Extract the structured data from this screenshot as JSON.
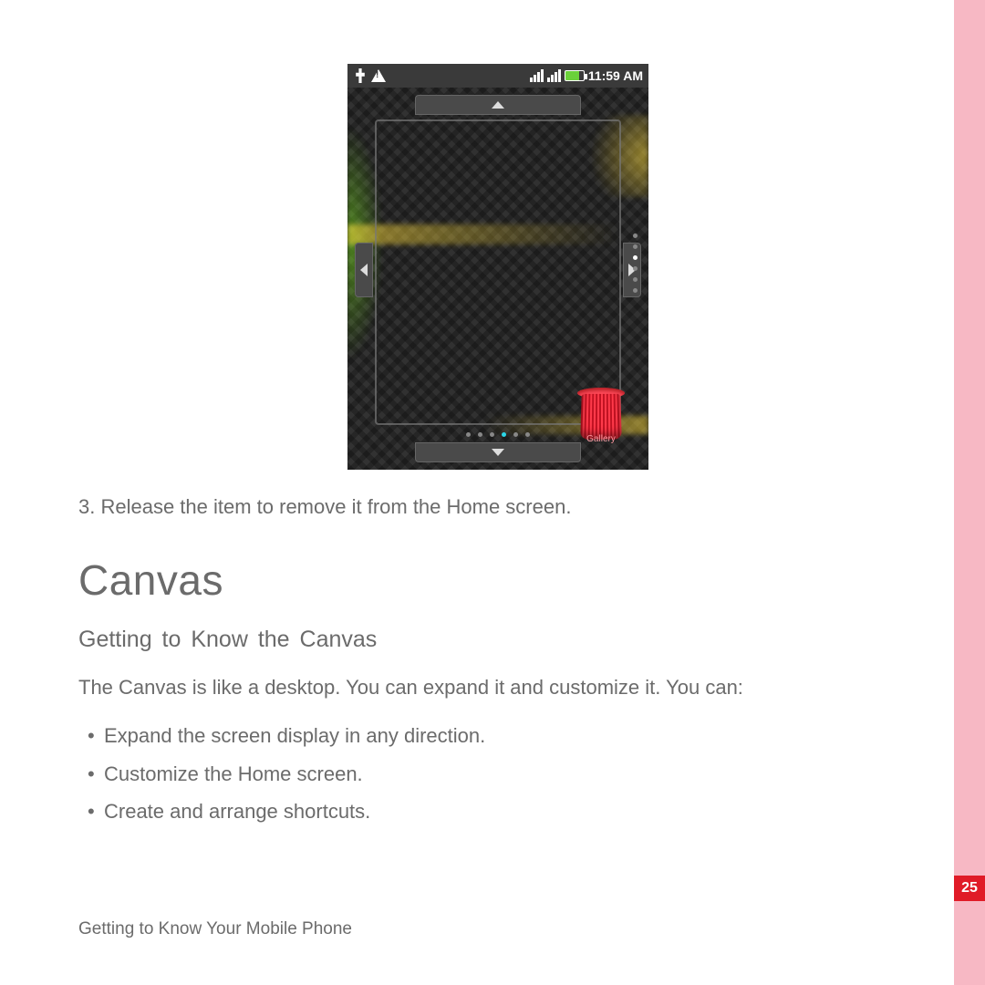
{
  "sidebar": {
    "page_number": "25"
  },
  "screenshot": {
    "status": {
      "time": "11:59 AM"
    },
    "page_dots_h": 6,
    "page_dots_h_active": 3,
    "page_dots_v": 6,
    "page_dots_v_active": 2,
    "trash_label": "Gallery"
  },
  "doc": {
    "step3": "3. Release the item to remove it from the Home screen.",
    "h1": "Canvas",
    "h2": "Getting to Know the Canvas",
    "para": "The Canvas is like a desktop. You can expand it and customize it. You can:",
    "bullets": [
      "Expand the screen display in any direction.",
      "Customize the Home screen.",
      "Create and arrange shortcuts."
    ],
    "footer": "Getting to Know Your Mobile Phone"
  }
}
